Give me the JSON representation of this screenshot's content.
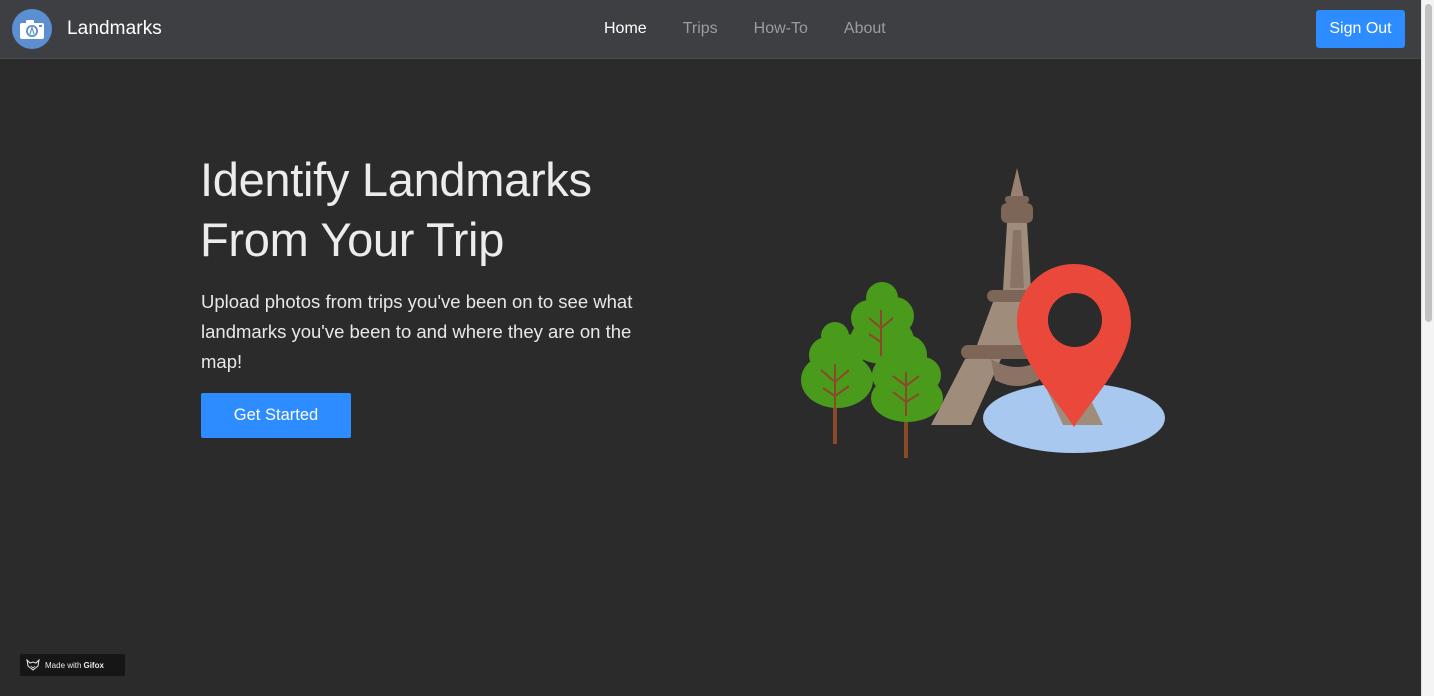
{
  "app": {
    "brand": "Landmarks",
    "logo_icon": "camera-icon"
  },
  "nav": {
    "items": [
      {
        "label": "Home",
        "active": true
      },
      {
        "label": "Trips",
        "active": false
      },
      {
        "label": "How-To",
        "active": false
      },
      {
        "label": "About",
        "active": false
      }
    ],
    "sign_out_label": "Sign Out"
  },
  "hero": {
    "title_line1": "Identify Landmarks",
    "title_line2": "From Your Trip",
    "description": "Upload photos from trips you've been on to see what landmarks you've been to and where they are on the map!",
    "cta_label": "Get Started",
    "illustration_icon": "eiffel-tower-map-pin-illustration"
  },
  "badge": {
    "prefix": "Made with",
    "name": "Gifox",
    "icon": "fox-icon"
  },
  "colors": {
    "navbar": "#3d3f42",
    "background": "#2b2b2b",
    "accent": "#2d8cff",
    "pin": "#e9483b",
    "tree": "#4a9a1b",
    "water": "#a8c8f0",
    "tower": "#8d7766"
  }
}
